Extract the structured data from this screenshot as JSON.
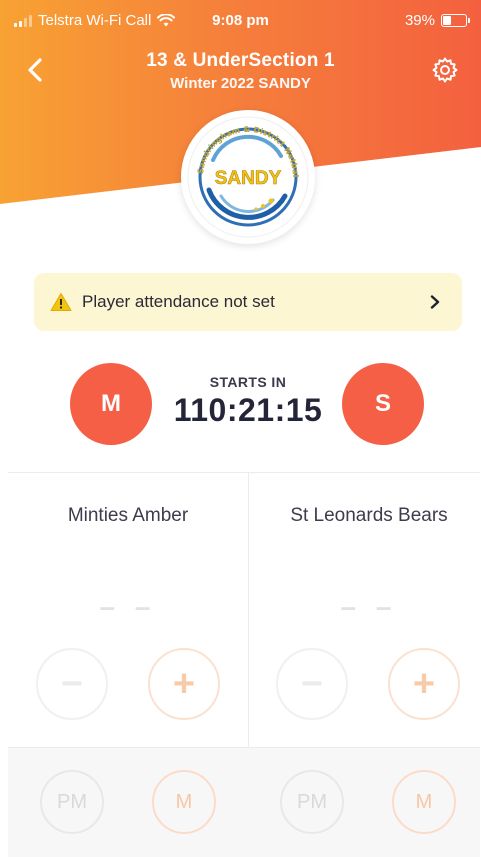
{
  "status_bar": {
    "carrier": "Telstra Wi-Fi Call",
    "time": "9:08 pm",
    "battery": "39%",
    "battery_level": 0.39
  },
  "header": {
    "title": "13 & UnderSection 1",
    "subtitle": "Winter 2022 SANDY",
    "back_icon": "chevron-left-icon",
    "settings_icon": "gear-icon"
  },
  "logo": {
    "arc_text": "Sandringham & District Netball Association",
    "center_text": "SANDY"
  },
  "alert": {
    "text": "Player attendance not set",
    "icon": "warning-icon",
    "chevron": "chevron-right-icon"
  },
  "match": {
    "home_initial": "M",
    "away_initial": "S",
    "starts_label": "STARTS IN",
    "countdown": "110:21:15"
  },
  "teams": {
    "home": {
      "name": "Minties Amber",
      "score": "– –",
      "minus": "−",
      "plus": "+",
      "chip_pm": "PM",
      "chip_m": "M"
    },
    "away": {
      "name": "St Leonards Bears",
      "score": "– –",
      "minus": "−",
      "plus": "+",
      "chip_pm": "PM",
      "chip_m": "M"
    }
  },
  "colors": {
    "gradient_start": "#f8a233",
    "gradient_end": "#f4603f",
    "accent": "#f45f45",
    "alert_bg": "#fdf6d3"
  }
}
